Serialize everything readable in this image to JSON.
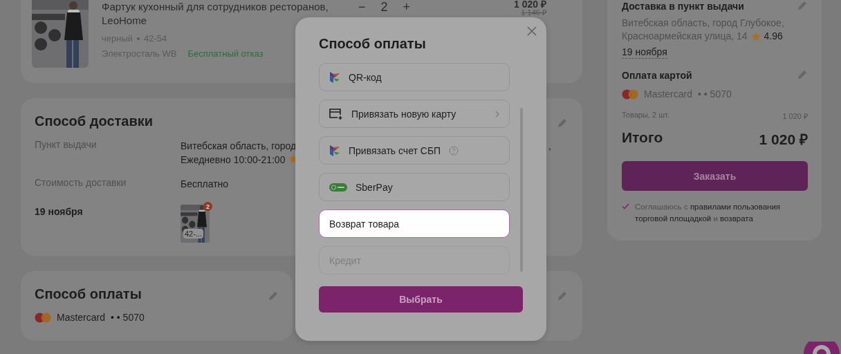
{
  "product": {
    "title": "Фартук кухонный для сотрудников ресторанов,",
    "brand": "LeoHome",
    "color_name": "черный",
    "sizes": "42-54",
    "warehouse": "Электросталь WB",
    "return_note": "Бесплатный отказ",
    "minus": "−",
    "quantity": "2",
    "plus": "+",
    "price": "1 020 ₽",
    "old_price": "1 146 ₽"
  },
  "delivery": {
    "title": "Способ доставки",
    "pickup_label": "Пункт выдачи",
    "pickup_address": "Витебская область, город",
    "pickup_tail": ",",
    "pickup_hours": "Ежедневно 10:00-21:00",
    "cost_label": "Стоимость доставки",
    "cost_value": "Бесплатно",
    "date": "19 ноября",
    "thumb_badge": "2",
    "thumb_label": "42-..."
  },
  "payment": {
    "title": "Способ оплаты",
    "card_name": "Mastercard",
    "card_mask": "• • 5070"
  },
  "summary": {
    "delivery_title": "Доставка в пункт выдачи",
    "address_lines": [
      "Витебская область, город Глубокое,",
      "Красноармейская улица, 14"
    ],
    "rating": "4.96",
    "date": "19 ноября",
    "payment_title": "Оплата картой",
    "card_name": "Mastercard",
    "card_mask": "• • 5070",
    "items_label": "Товары, 2 шт.",
    "items_sum": "1 020 ₽",
    "total_label": "Итого",
    "total": "1 020 ₽",
    "order_button": "Заказать",
    "agree_checked": true,
    "agreement": "Соглашаюсь с **правилами пользования торговой площадкой** и **возврата**"
  },
  "modal": {
    "title": "Способ оплаты",
    "options": [
      {
        "kind": "sbp",
        "label": "QR-код",
        "selected": false,
        "disabled": false
      },
      {
        "kind": "new_card",
        "label": "Привязать новую карту",
        "selected": false,
        "disabled": false
      },
      {
        "kind": "sbp_account",
        "label": "Привязать счет СБП",
        "selected": false,
        "disabled": false
      },
      {
        "kind": "sberpay",
        "label": "SberPay",
        "selected": false,
        "disabled": false
      },
      {
        "kind": "plain",
        "label": "Возврат товара",
        "selected": true,
        "disabled": false
      },
      {
        "kind": "plain",
        "label": "Кредит",
        "selected": false,
        "disabled": true
      }
    ],
    "select_button": "Выбрать"
  }
}
